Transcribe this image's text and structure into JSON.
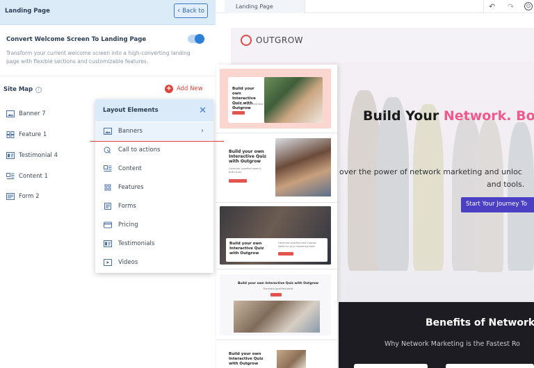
{
  "panel": {
    "title": "Landing Page",
    "back_label": "Back to",
    "convert_title": "Convert Welcome Screen To Landing Page",
    "convert_desc": "Transform your current welcome screen into a high-converting landing page with flexible sections and customizable features.",
    "toggle_on": true,
    "sitemap_label": "Site Map",
    "add_new_label": "Add New",
    "sitemap_items": [
      {
        "label": "Banner 7",
        "icon": "image-icon"
      },
      {
        "label": "Feature 1",
        "icon": "grid-icon"
      },
      {
        "label": "Testimonial 4",
        "icon": "testimonial-icon"
      },
      {
        "label": "Content 1",
        "icon": "content-icon"
      },
      {
        "label": "Form 2",
        "icon": "form-icon"
      }
    ]
  },
  "dropdown": {
    "title": "Layout Elements",
    "items": [
      {
        "label": "Banners",
        "icon": "image-icon",
        "active": true
      },
      {
        "label": "Call to actions",
        "icon": "cursor-icon"
      },
      {
        "label": "Content",
        "icon": "content-icon"
      },
      {
        "label": "Features",
        "icon": "grid-icon"
      },
      {
        "label": "Forms",
        "icon": "form-icon"
      },
      {
        "label": "Pricing",
        "icon": "card-icon"
      },
      {
        "label": "Testimonials",
        "icon": "testimonial-icon"
      },
      {
        "label": "Videos",
        "icon": "video-icon"
      }
    ]
  },
  "thumbs": {
    "t1_title": "Build your own Interactive Quiz with Outgrow",
    "t1_sub": "Generate a qualified lead in a few steps",
    "t2_title": "Build your own Interactive Quiz with Outgrow",
    "t2_sub": "Generate qualified leads & build trust",
    "t3_title": "Build your own Interactive Quiz with Outgrow",
    "t3_sub": "Generate qualified and interest leads for your marketing team",
    "t4_title": "Build your own Interactive Quiz with Outgrow",
    "t4_sub": "Generate qualified leads",
    "t5_title": "Build your own Interactive Quiz with Outgrow"
  },
  "topbar": {
    "tab_label": "Landing Page"
  },
  "preview": {
    "logo_text": "OUTGROW",
    "hero_title_a": "Build Your ",
    "hero_title_b": "Network. Boo",
    "hero_sub1": "over the power of network marketing and unloc",
    "hero_sub2": "and tools.",
    "hero_btn": "Start Your Journey To",
    "benefits_title": "Benefits of Network",
    "benefits_sub": "Why Network Marketing is the Fastest Ro"
  },
  "colors": {
    "accent_blue": "#2f7fd8",
    "add_red": "#e0413a",
    "brand_pink": "#ee5a8c",
    "cta_purple": "#4b3fc4",
    "dark_band": "#1c1c22"
  }
}
